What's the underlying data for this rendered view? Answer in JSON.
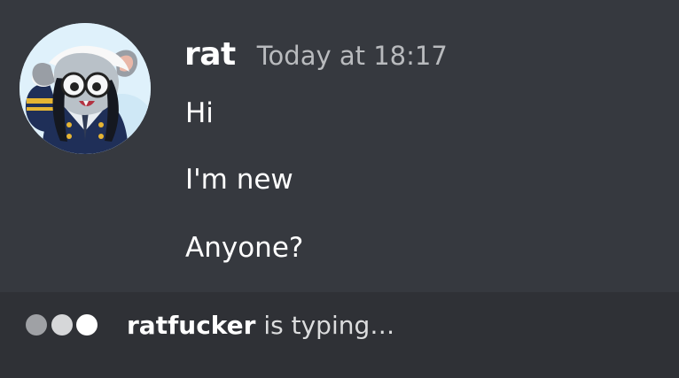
{
  "message": {
    "author": "rat",
    "timestamp": "Today at 18:17",
    "avatar_icon": "sailor-rat-avatar",
    "lines": [
      "Hi",
      "I'm new",
      "Anyone?"
    ]
  },
  "typing": {
    "username": "ratfucker",
    "suffix": " is typing…",
    "indicator_icon": "typing-dots-icon"
  },
  "colors": {
    "background": "#36393f",
    "typing_bar": "#2f3136",
    "username": "#ffffff",
    "timestamp": "#b9bbbe",
    "text": "#ffffff"
  }
}
